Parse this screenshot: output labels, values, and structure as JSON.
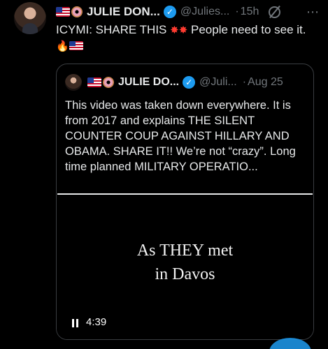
{
  "tweet": {
    "author": {
      "name": "JULIE DON...",
      "handle": "@Julies...",
      "separator": "·",
      "time": "15h"
    },
    "more_icon": "⋯",
    "text_main": "ICYMI: SHARE THIS",
    "text_tail": "People need to see",
    "text_end": "it.",
    "emoji": {
      "burst": "✸",
      "fire": "🔥"
    }
  },
  "quote": {
    "author": {
      "name": "JULIE DO...",
      "handle": "@Juli...",
      "separator": "·",
      "time": "Aug 25"
    },
    "text": "This video was taken down everywhere. It is from 2017 and explains THE SILENT COUNTER COUP AGAINST HILLARY AND OBAMA. SHARE IT!! We’re not “crazy”. Long time planned MILITARY OPERATIO...",
    "video": {
      "caption_line1": "As THEY met",
      "caption_line2": "in Davos",
      "duration": "4:39"
    }
  },
  "colors": {
    "background": "#000000",
    "text": "#e7e9ea",
    "muted": "#71767b",
    "verified": "#1d9bf0",
    "border": "#3a3d41"
  },
  "icons": [
    "verified-badge-icon",
    "grok-icon",
    "more-icon",
    "pause-icon",
    "flag-emoji",
    "donut-emoji",
    "fire-emoji"
  ]
}
